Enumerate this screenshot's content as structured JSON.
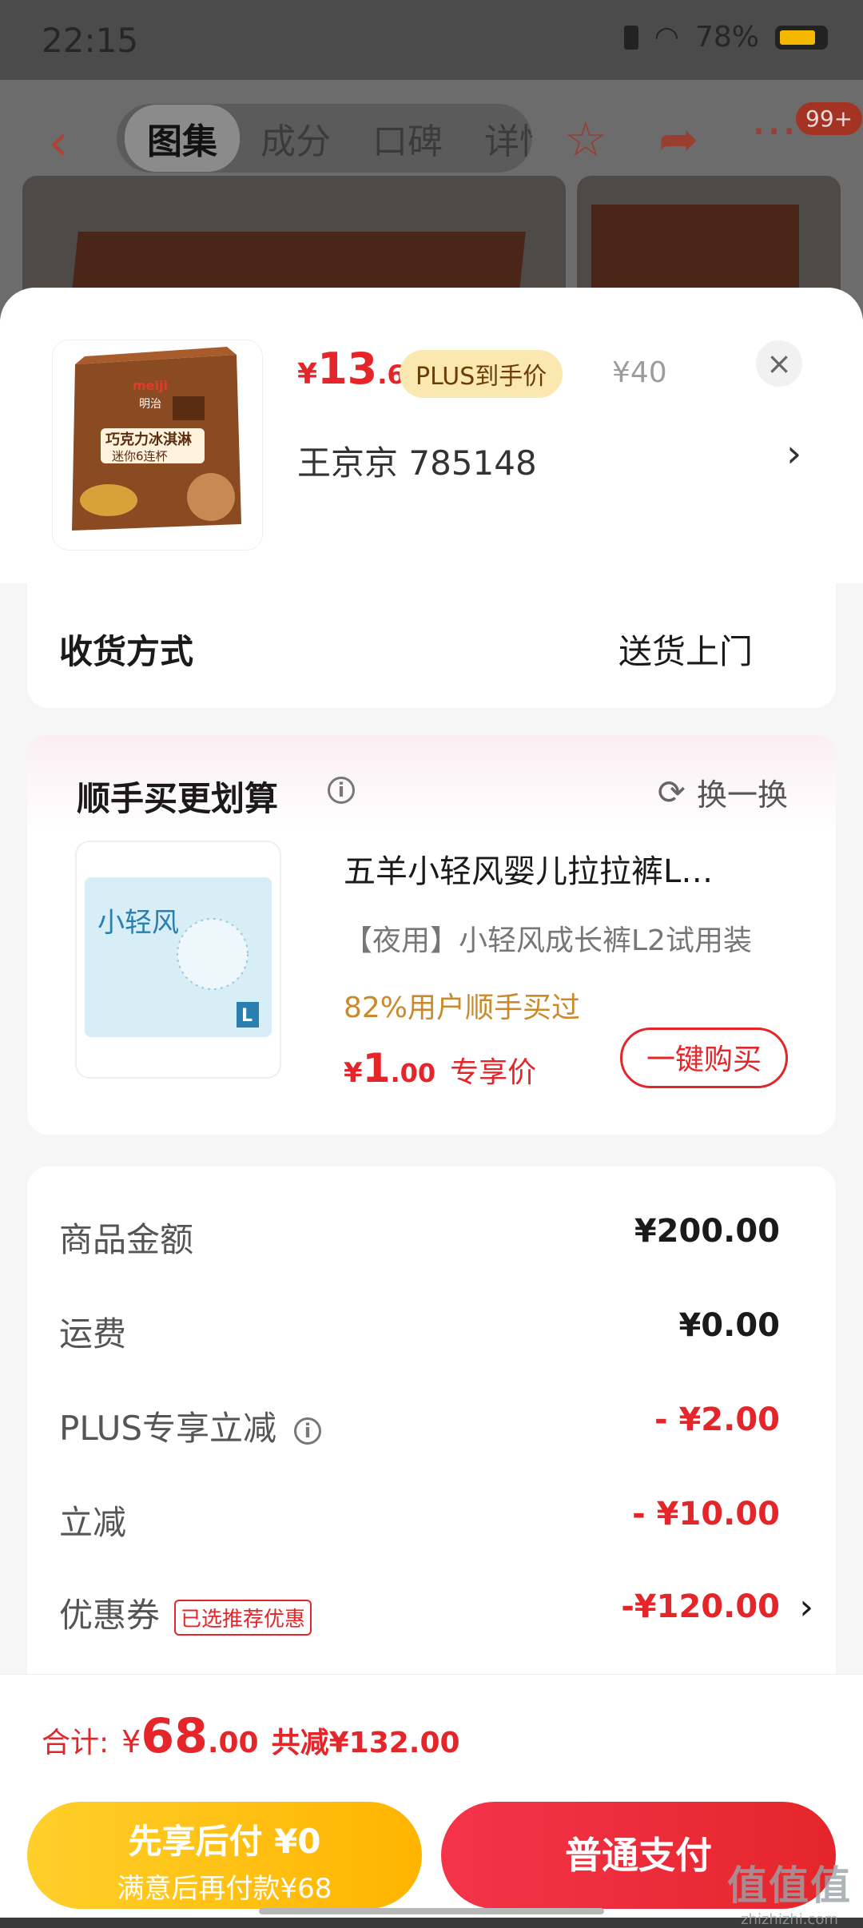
{
  "status_bar": {
    "time": "22:15",
    "battery": "78%"
  },
  "nav": {
    "tabs": [
      "图集",
      "成分",
      "口碑",
      "详情"
    ],
    "active_tab": "图集",
    "badge": "99+"
  },
  "product": {
    "price_symbol": "¥",
    "price_int": "13",
    "price_dec": ".6",
    "plus_tag": "PLUS到手价",
    "original_price": "¥40",
    "spec": "王京京  785148",
    "image_brand": "meiji",
    "image_line1": "明治",
    "image_line2": "巧克力冰淇淋",
    "image_line3": "迷你6连杯"
  },
  "delivery": {
    "label": "收货方式",
    "value": "送货上门"
  },
  "upsell": {
    "title": "顺手买更划算",
    "refresh_label": "换一换",
    "item_name": "五羊小轻风婴儿拉拉裤L…",
    "item_subtitle": "【夜用】小轻风成长裤L2试用装",
    "item_stat": "82%用户顺手买过",
    "price_symbol": "¥",
    "price_int": "1",
    "price_dec": ".00",
    "price_tag": "专享价",
    "buy_label": "一键购买",
    "image_text": "小轻风",
    "image_size": "L"
  },
  "amounts": [
    {
      "label": "商品金额",
      "value": "¥200.00",
      "color": "#1a1a1a"
    },
    {
      "label": "运费",
      "value": "¥0.00",
      "color": "#1a1a1a"
    },
    {
      "label": "PLUS专享立减",
      "value": "- ¥2.00",
      "color": "#e4262b"
    },
    {
      "label": "立减",
      "value": "- ¥10.00",
      "color": "#e4262b"
    },
    {
      "label": "优惠券",
      "value": "-¥120.00",
      "color": "#e4262b",
      "tag": "已选推荐优惠"
    }
  ],
  "total": {
    "label": "合计:",
    "symbol": "¥",
    "int": "68",
    "dec": ".00",
    "reduced": "共减¥132.00"
  },
  "buttons": {
    "pay_later_line1": "先享后付 ¥0",
    "pay_later_line2": "满意后再付款¥68",
    "pay_now": "普通支付"
  },
  "watermark": {
    "line1": "值值值",
    "line2": "zhizhizhi.com"
  },
  "colors": {
    "accent": "#e4262b",
    "gold": "#ffb400",
    "stat": "#c98a2b"
  }
}
